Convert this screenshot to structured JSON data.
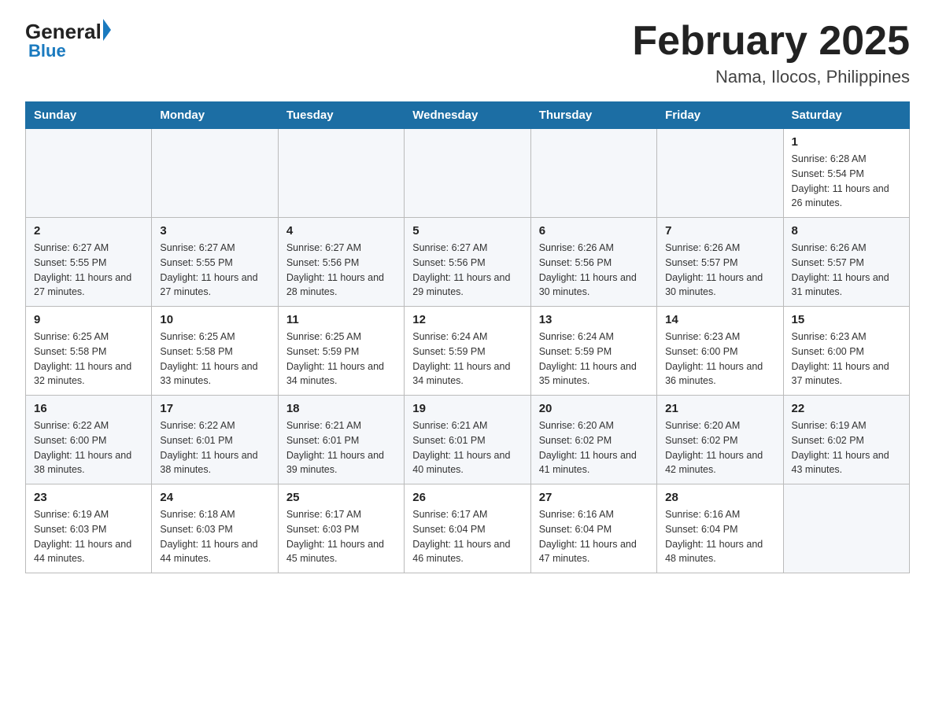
{
  "header": {
    "logo_general": "General",
    "logo_blue": "Blue",
    "title": "February 2025",
    "subtitle": "Nama, Ilocos, Philippines"
  },
  "days_of_week": [
    "Sunday",
    "Monday",
    "Tuesday",
    "Wednesday",
    "Thursday",
    "Friday",
    "Saturday"
  ],
  "weeks": [
    {
      "days": [
        {
          "num": "",
          "info": ""
        },
        {
          "num": "",
          "info": ""
        },
        {
          "num": "",
          "info": ""
        },
        {
          "num": "",
          "info": ""
        },
        {
          "num": "",
          "info": ""
        },
        {
          "num": "",
          "info": ""
        },
        {
          "num": "1",
          "info": "Sunrise: 6:28 AM\nSunset: 5:54 PM\nDaylight: 11 hours and 26 minutes."
        }
      ]
    },
    {
      "days": [
        {
          "num": "2",
          "info": "Sunrise: 6:27 AM\nSunset: 5:55 PM\nDaylight: 11 hours and 27 minutes."
        },
        {
          "num": "3",
          "info": "Sunrise: 6:27 AM\nSunset: 5:55 PM\nDaylight: 11 hours and 27 minutes."
        },
        {
          "num": "4",
          "info": "Sunrise: 6:27 AM\nSunset: 5:56 PM\nDaylight: 11 hours and 28 minutes."
        },
        {
          "num": "5",
          "info": "Sunrise: 6:27 AM\nSunset: 5:56 PM\nDaylight: 11 hours and 29 minutes."
        },
        {
          "num": "6",
          "info": "Sunrise: 6:26 AM\nSunset: 5:56 PM\nDaylight: 11 hours and 30 minutes."
        },
        {
          "num": "7",
          "info": "Sunrise: 6:26 AM\nSunset: 5:57 PM\nDaylight: 11 hours and 30 minutes."
        },
        {
          "num": "8",
          "info": "Sunrise: 6:26 AM\nSunset: 5:57 PM\nDaylight: 11 hours and 31 minutes."
        }
      ]
    },
    {
      "days": [
        {
          "num": "9",
          "info": "Sunrise: 6:25 AM\nSunset: 5:58 PM\nDaylight: 11 hours and 32 minutes."
        },
        {
          "num": "10",
          "info": "Sunrise: 6:25 AM\nSunset: 5:58 PM\nDaylight: 11 hours and 33 minutes."
        },
        {
          "num": "11",
          "info": "Sunrise: 6:25 AM\nSunset: 5:59 PM\nDaylight: 11 hours and 34 minutes."
        },
        {
          "num": "12",
          "info": "Sunrise: 6:24 AM\nSunset: 5:59 PM\nDaylight: 11 hours and 34 minutes."
        },
        {
          "num": "13",
          "info": "Sunrise: 6:24 AM\nSunset: 5:59 PM\nDaylight: 11 hours and 35 minutes."
        },
        {
          "num": "14",
          "info": "Sunrise: 6:23 AM\nSunset: 6:00 PM\nDaylight: 11 hours and 36 minutes."
        },
        {
          "num": "15",
          "info": "Sunrise: 6:23 AM\nSunset: 6:00 PM\nDaylight: 11 hours and 37 minutes."
        }
      ]
    },
    {
      "days": [
        {
          "num": "16",
          "info": "Sunrise: 6:22 AM\nSunset: 6:00 PM\nDaylight: 11 hours and 38 minutes."
        },
        {
          "num": "17",
          "info": "Sunrise: 6:22 AM\nSunset: 6:01 PM\nDaylight: 11 hours and 38 minutes."
        },
        {
          "num": "18",
          "info": "Sunrise: 6:21 AM\nSunset: 6:01 PM\nDaylight: 11 hours and 39 minutes."
        },
        {
          "num": "19",
          "info": "Sunrise: 6:21 AM\nSunset: 6:01 PM\nDaylight: 11 hours and 40 minutes."
        },
        {
          "num": "20",
          "info": "Sunrise: 6:20 AM\nSunset: 6:02 PM\nDaylight: 11 hours and 41 minutes."
        },
        {
          "num": "21",
          "info": "Sunrise: 6:20 AM\nSunset: 6:02 PM\nDaylight: 11 hours and 42 minutes."
        },
        {
          "num": "22",
          "info": "Sunrise: 6:19 AM\nSunset: 6:02 PM\nDaylight: 11 hours and 43 minutes."
        }
      ]
    },
    {
      "days": [
        {
          "num": "23",
          "info": "Sunrise: 6:19 AM\nSunset: 6:03 PM\nDaylight: 11 hours and 44 minutes."
        },
        {
          "num": "24",
          "info": "Sunrise: 6:18 AM\nSunset: 6:03 PM\nDaylight: 11 hours and 44 minutes."
        },
        {
          "num": "25",
          "info": "Sunrise: 6:17 AM\nSunset: 6:03 PM\nDaylight: 11 hours and 45 minutes."
        },
        {
          "num": "26",
          "info": "Sunrise: 6:17 AM\nSunset: 6:04 PM\nDaylight: 11 hours and 46 minutes."
        },
        {
          "num": "27",
          "info": "Sunrise: 6:16 AM\nSunset: 6:04 PM\nDaylight: 11 hours and 47 minutes."
        },
        {
          "num": "28",
          "info": "Sunrise: 6:16 AM\nSunset: 6:04 PM\nDaylight: 11 hours and 48 minutes."
        },
        {
          "num": "",
          "info": ""
        }
      ]
    }
  ]
}
